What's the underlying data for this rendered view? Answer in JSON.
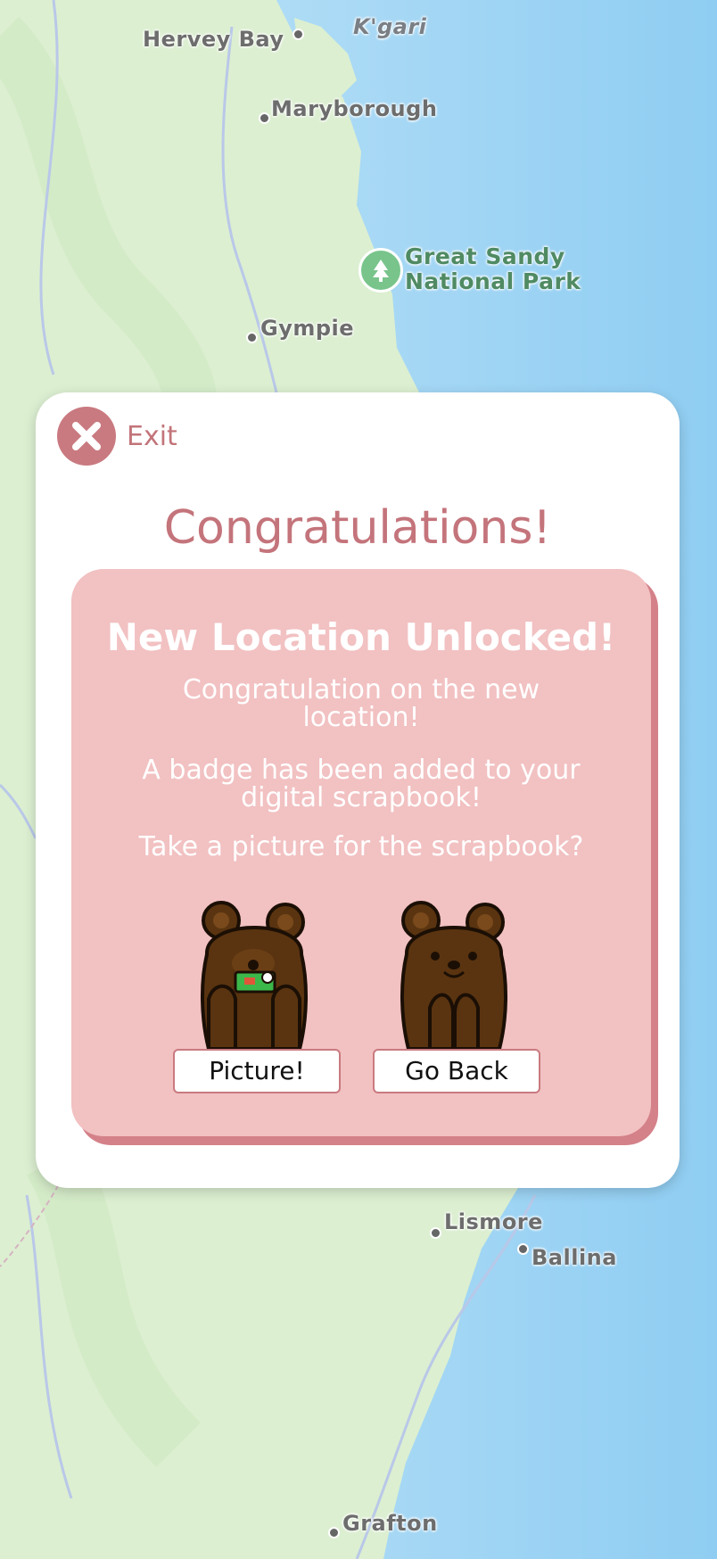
{
  "map": {
    "labels": {
      "hervey_bay": "Hervey Bay",
      "kgari": "K'gari",
      "maryborough": "Maryborough",
      "park_line1": "Great Sandy",
      "park_line2": "National Park",
      "gympie": "Gympie",
      "lismore": "Lismore",
      "ballina": "Ballina",
      "grafton": "Grafton"
    },
    "colors": {
      "land": "#dcefd1",
      "sea": "#a8d8f5",
      "road": "#b9c8e8"
    }
  },
  "modal": {
    "exit_label": "Exit",
    "exit_icon": "close-icon",
    "title": "Congratulations!",
    "card": {
      "heading": "New Location Unlocked!",
      "message1": "Congratulation on the new location!",
      "message2": "A badge has been added to your digital scrapbook!",
      "message3": "Take a picture for the scrapbook?"
    },
    "buttons": {
      "picture": "Picture!",
      "go_back": "Go Back"
    },
    "colors": {
      "accent": "#c4747b",
      "card": "#f2c1c2",
      "card_shadow": "#d48189"
    }
  }
}
